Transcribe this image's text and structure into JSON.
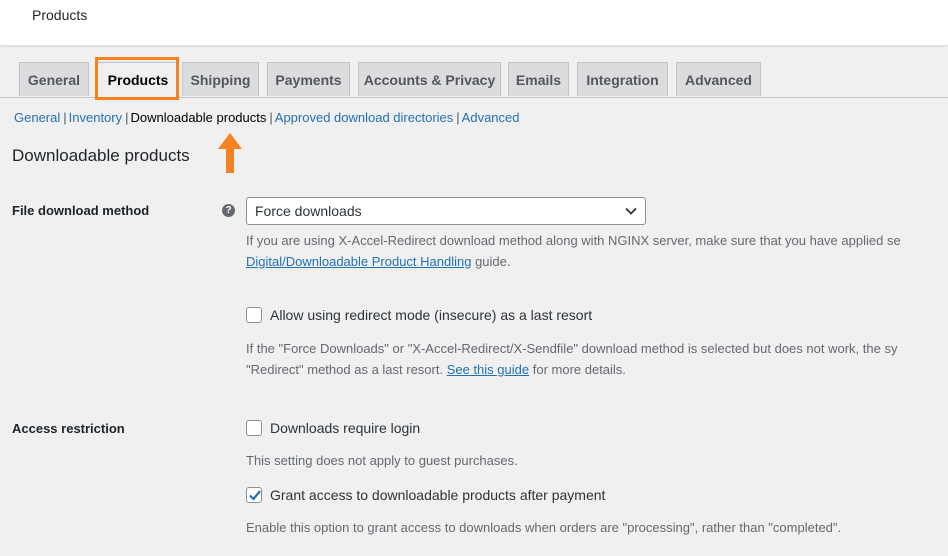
{
  "header": {
    "title": "Products"
  },
  "tabs": [
    {
      "label": "General"
    },
    {
      "label": "Products"
    },
    {
      "label": "Shipping"
    },
    {
      "label": "Payments"
    },
    {
      "label": "Accounts & Privacy"
    },
    {
      "label": "Emails"
    },
    {
      "label": "Integration"
    },
    {
      "label": "Advanced"
    }
  ],
  "sections": [
    {
      "label": "General"
    },
    {
      "label": "Inventory"
    },
    {
      "label": "Downloadable products"
    },
    {
      "label": "Approved download directories"
    },
    {
      "label": "Advanced"
    }
  ],
  "separator": "|",
  "page_heading": "Downloadable products",
  "file_download": {
    "label": "File download method",
    "help_icon": "?",
    "selected": "Force downloads",
    "desc_line1": "If you are using X-Accel-Redirect download method along with NGINX server, make sure that you have applied se",
    "desc_link": "Digital/Downloadable Product Handling",
    "desc_after_link": " guide.",
    "redirect_label": "Allow using redirect mode (insecure) as a last resort",
    "redirect_desc_line1": "If the \"Force Downloads\" or \"X-Accel-Redirect/X-Sendfile\" download method is selected but does not work, the sy",
    "redirect_desc_pre": "\"Redirect\" method as a last resort. ",
    "redirect_desc_link": "See this guide",
    "redirect_desc_post": " for more details."
  },
  "access": {
    "label": "Access restriction",
    "login_label": "Downloads require login",
    "login_desc": "This setting does not apply to guest purchases.",
    "grant_label": "Grant access to downloadable products after payment",
    "grant_desc": "Enable this option to grant access to downloads when orders are \"processing\", rather than \"completed\"."
  },
  "colors": {
    "highlight": "#f58220",
    "link": "#2271b1"
  },
  "icons": {
    "arrow": "up-arrow-icon",
    "select": "chevron-down-icon",
    "check": "checkmark-icon"
  }
}
